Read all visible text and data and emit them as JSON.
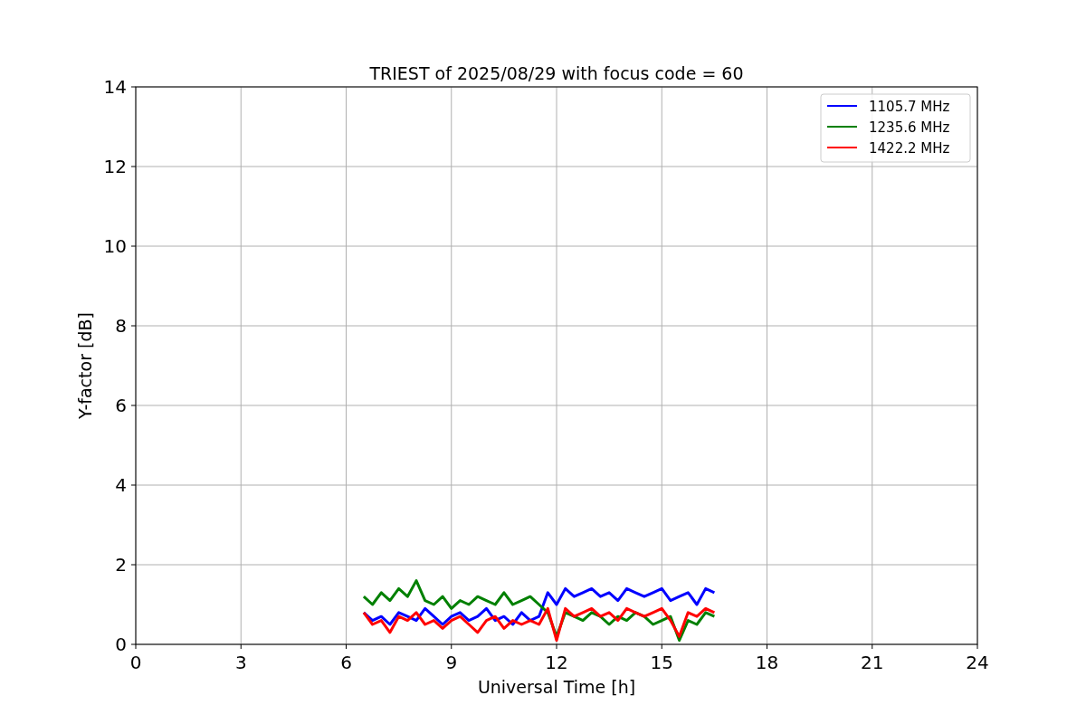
{
  "chart_data": {
    "type": "line",
    "title": "TRIEST of 2025/08/29 with focus code = 60",
    "xlabel": "Universal Time [h]",
    "ylabel": "Y-factor [dB]",
    "x": [
      6.5,
      6.75,
      7,
      7.25,
      7.5,
      7.75,
      8,
      8.25,
      8.5,
      8.75,
      9,
      9.25,
      9.5,
      9.75,
      10,
      10.25,
      10.5,
      10.75,
      11,
      11.25,
      11.5,
      11.75,
      12,
      12.25,
      12.5,
      12.75,
      13,
      13.25,
      13.5,
      13.75,
      14,
      14.25,
      14.5,
      14.75,
      15,
      15.25,
      15.5,
      15.75,
      16,
      16.25,
      16.5
    ],
    "series": [
      {
        "name": "1105.7 MHz",
        "color": "#0000ff",
        "values": [
          0.8,
          0.6,
          0.7,
          0.5,
          0.8,
          0.7,
          0.6,
          0.9,
          0.7,
          0.5,
          0.7,
          0.8,
          0.6,
          0.7,
          0.9,
          0.6,
          0.7,
          0.5,
          0.8,
          0.6,
          0.7,
          1.3,
          1.0,
          1.4,
          1.2,
          1.3,
          1.4,
          1.2,
          1.3,
          1.1,
          1.4,
          1.3,
          1.2,
          1.3,
          1.4,
          1.1,
          1.2,
          1.3,
          1.0,
          1.4,
          1.3
        ]
      },
      {
        "name": "1235.6 MHz",
        "color": "#008000",
        "values": [
          1.2,
          1.0,
          1.3,
          1.1,
          1.4,
          1.2,
          1.6,
          1.1,
          1.0,
          1.2,
          0.9,
          1.1,
          1.0,
          1.2,
          1.1,
          1.0,
          1.3,
          1.0,
          1.1,
          1.2,
          1.0,
          0.8,
          0.2,
          0.8,
          0.7,
          0.6,
          0.8,
          0.7,
          0.5,
          0.7,
          0.6,
          0.8,
          0.7,
          0.5,
          0.6,
          0.7,
          0.1,
          0.6,
          0.5,
          0.8,
          0.7
        ]
      },
      {
        "name": "1422.2 MHz",
        "color": "#ff0000",
        "values": [
          0.8,
          0.5,
          0.6,
          0.3,
          0.7,
          0.6,
          0.8,
          0.5,
          0.6,
          0.4,
          0.6,
          0.7,
          0.5,
          0.3,
          0.6,
          0.7,
          0.4,
          0.6,
          0.5,
          0.6,
          0.5,
          0.9,
          0.1,
          0.9,
          0.7,
          0.8,
          0.9,
          0.7,
          0.8,
          0.6,
          0.9,
          0.8,
          0.7,
          0.8,
          0.9,
          0.6,
          0.2,
          0.8,
          0.7,
          0.9,
          0.8
        ]
      }
    ],
    "grid": true,
    "legend": true,
    "xlim": [
      0,
      24
    ],
    "ylim": [
      0,
      14
    ],
    "xticks": [
      0,
      3,
      6,
      9,
      12,
      15,
      18,
      21,
      24
    ],
    "yticks": [
      0,
      2,
      4,
      6,
      8,
      10,
      12,
      14
    ]
  }
}
